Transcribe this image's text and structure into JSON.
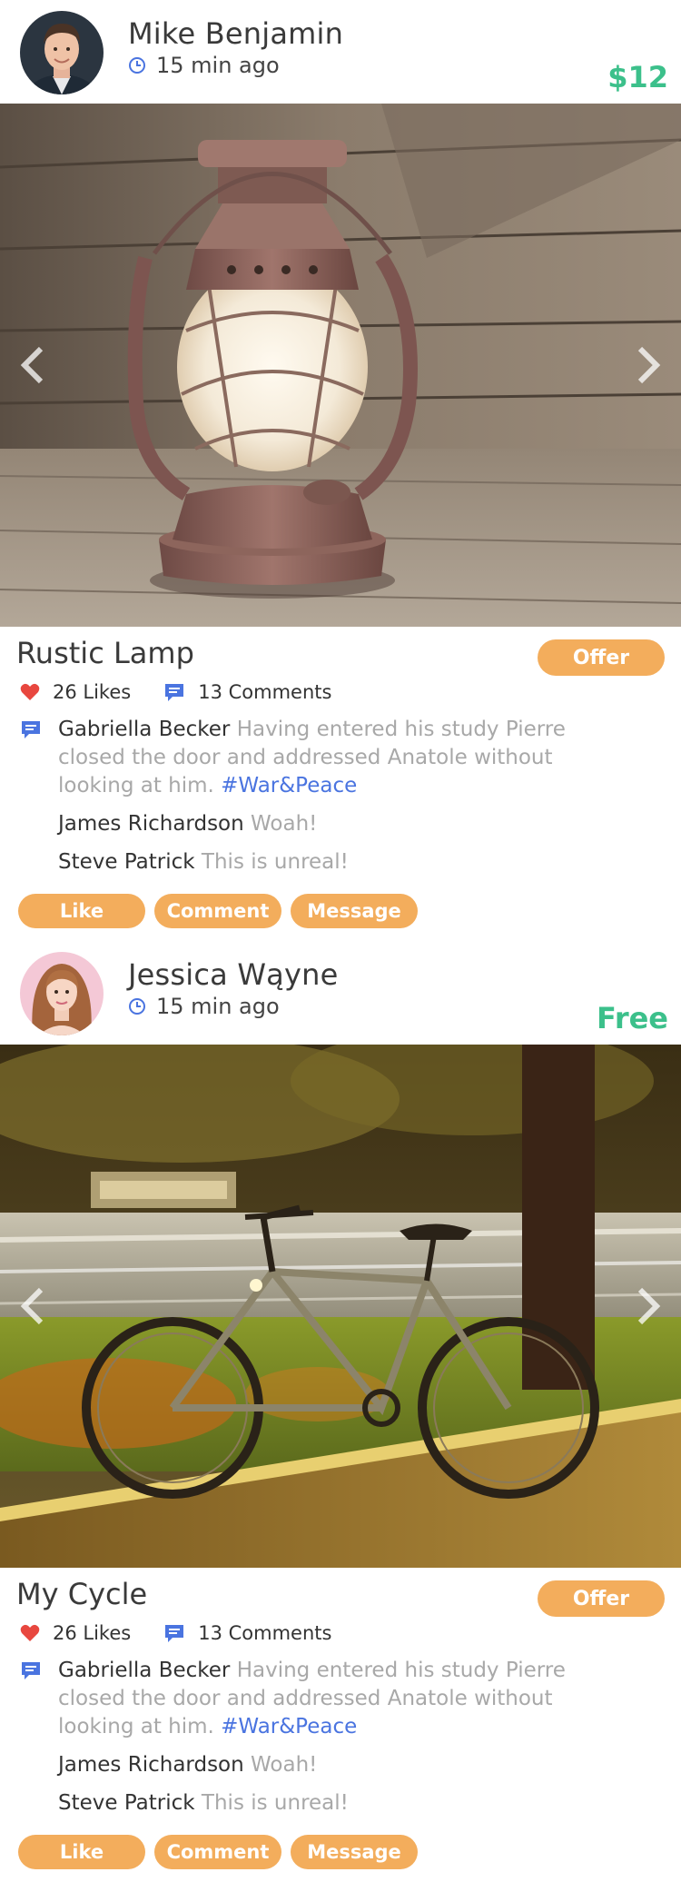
{
  "posts": [
    {
      "author": "Mike Benjamin",
      "time": "15 min ago",
      "price": "$12",
      "title": "Rustic Lamp",
      "offer_label": "Offer",
      "likes": "26 Likes",
      "comments_count": "13 Comments",
      "comments": [
        {
          "name": "Gabriella Becker",
          "text": "Having entered his study Pierre closed the door and addressed Anatole without looking at him.",
          "tag": "#War&Peace"
        },
        {
          "name": "James Richardson",
          "text": "Woah!",
          "tag": ""
        },
        {
          "name": "Steve Patrick",
          "text": "This is unreal!",
          "tag": ""
        }
      ],
      "actions": {
        "like": "Like",
        "comment": "Comment",
        "message": "Message"
      }
    },
    {
      "author": "Jessica Wąyne",
      "time": "15 min ago",
      "price": "Free",
      "title": "My Cycle",
      "offer_label": "Offer",
      "likes": "26 Likes",
      "comments_count": "13 Comments",
      "comments": [
        {
          "name": "Gabriella Becker",
          "text": "Having entered his study Pierre closed the door and addressed Anatole without looking at him.",
          "tag": "#War&Peace"
        },
        {
          "name": "James Richardson",
          "text": "Woah!",
          "tag": ""
        },
        {
          "name": "Steve Patrick",
          "text": "This is unreal!",
          "tag": ""
        }
      ],
      "actions": {
        "like": "Like",
        "comment": "Comment",
        "message": "Message"
      }
    }
  ],
  "icons": {
    "clock": "clock-icon",
    "heart": "heart-icon",
    "comment": "comment-bubble-icon",
    "prev": "chevron-left-icon",
    "next": "chevron-right-icon"
  },
  "colors": {
    "accent_orange": "#f3ad5c",
    "price_green": "#3cc08b",
    "link_blue": "#4a74e0",
    "heart_red": "#e8473f",
    "muted_text": "#a8a8a8"
  }
}
